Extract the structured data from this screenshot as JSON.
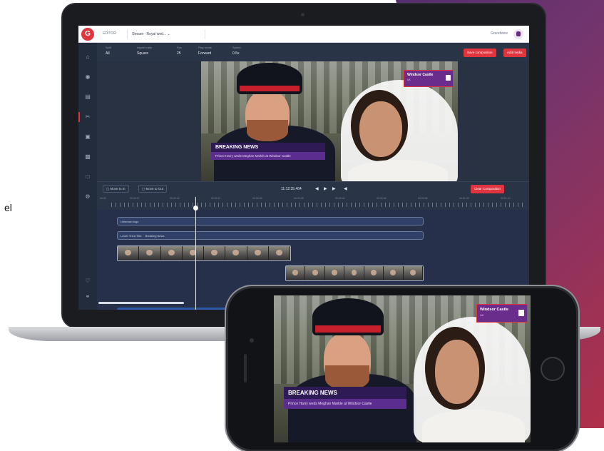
{
  "page": {
    "edge_text": "el"
  },
  "app": {
    "logo_letter": "G",
    "topbar": {
      "section": "EDITOR",
      "stream_selector": "Stream - Royal wed...",
      "user_name": "Grandview"
    },
    "controls": {
      "split": {
        "label": "Split",
        "value": "All"
      },
      "aspect": {
        "label": "Aspect ratio",
        "value": "Square"
      },
      "fps": {
        "label": "Fps",
        "value": "25"
      },
      "play_mode": {
        "label": "Play mode",
        "value": "Forward"
      },
      "speed": {
        "label": "Speed",
        "value": "0.5x"
      },
      "save_button": "Save composition",
      "add_media_button": "Add media"
    },
    "preview": {
      "breaking_title": "BREAKING NEWS",
      "breaking_sub": "Prince Harry weds Meghan Markle at Windsor Castle",
      "badge_title": "Windsor Castle",
      "badge_sub": "UK"
    },
    "transport": {
      "move_in_button": "Move to In",
      "move_out_button": "Move to Out",
      "timecode": "11:12:35.404",
      "clear_button": "Clear Composition"
    },
    "ruler_labels": [
      "00:00",
      "00:00:07",
      "00:00:14",
      "00:00:21",
      "00:00:28",
      "00:00:35",
      "00:00:42",
      "00:00:49",
      "00:00:56",
      "00:01:03",
      "00:01:10"
    ],
    "tracks": {
      "bar1": "Unknown logo",
      "bar2_a": "Lower Third Title",
      "bar2_b": "Breaking News"
    }
  },
  "phone": {
    "breaking_title": "BREAKING NEWS",
    "breaking_sub": "Prince Harry weds Meghan Markle at Windsor Castle",
    "badge_title": "Windsor Castle",
    "badge_sub": "UK"
  },
  "colors": {
    "accent_red": "#e0343f",
    "brand_purple": "#6b2d8c",
    "editor_bg": "#2a3447"
  }
}
